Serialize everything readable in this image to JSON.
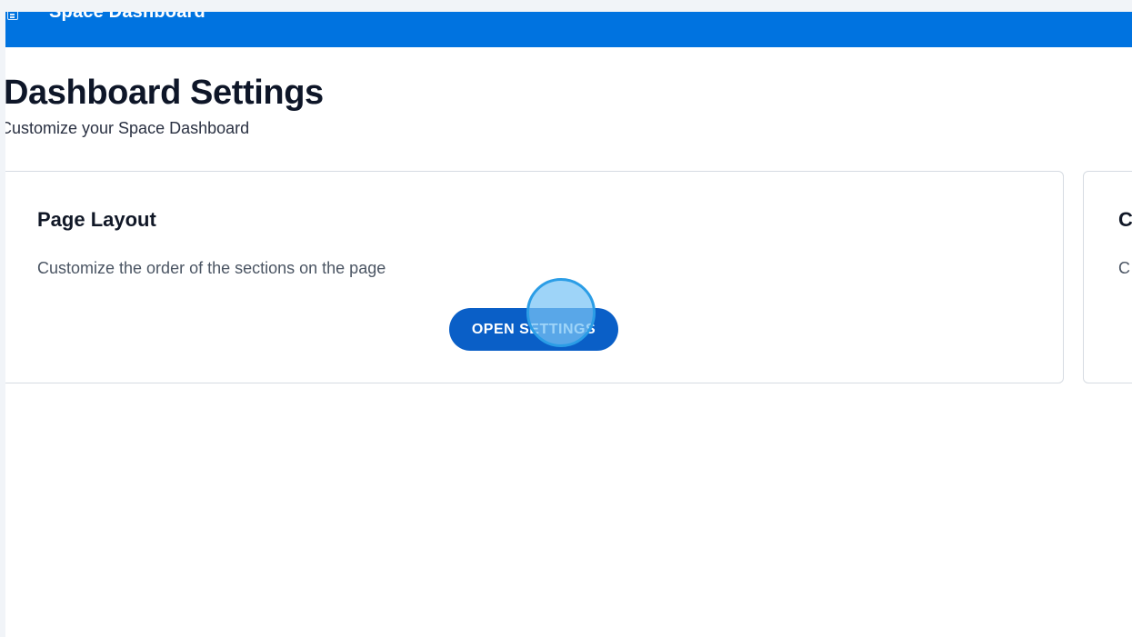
{
  "topbar": {
    "title": "Space Dashboard",
    "icon": "dashboard-icon",
    "color": "#0073e0"
  },
  "page": {
    "title": "Dashboard Settings",
    "subtitle": "Customize your Space Dashboard"
  },
  "cards": [
    {
      "title": "Page Layout",
      "description": "Customize the order of the sections on the page",
      "button_label": "OPEN SETTINGS"
    },
    {
      "title": "C",
      "description": "C"
    }
  ],
  "colors": {
    "accent": "#0073e0",
    "button": "#0a5fc7",
    "click_indicator": "#2b9de6"
  }
}
